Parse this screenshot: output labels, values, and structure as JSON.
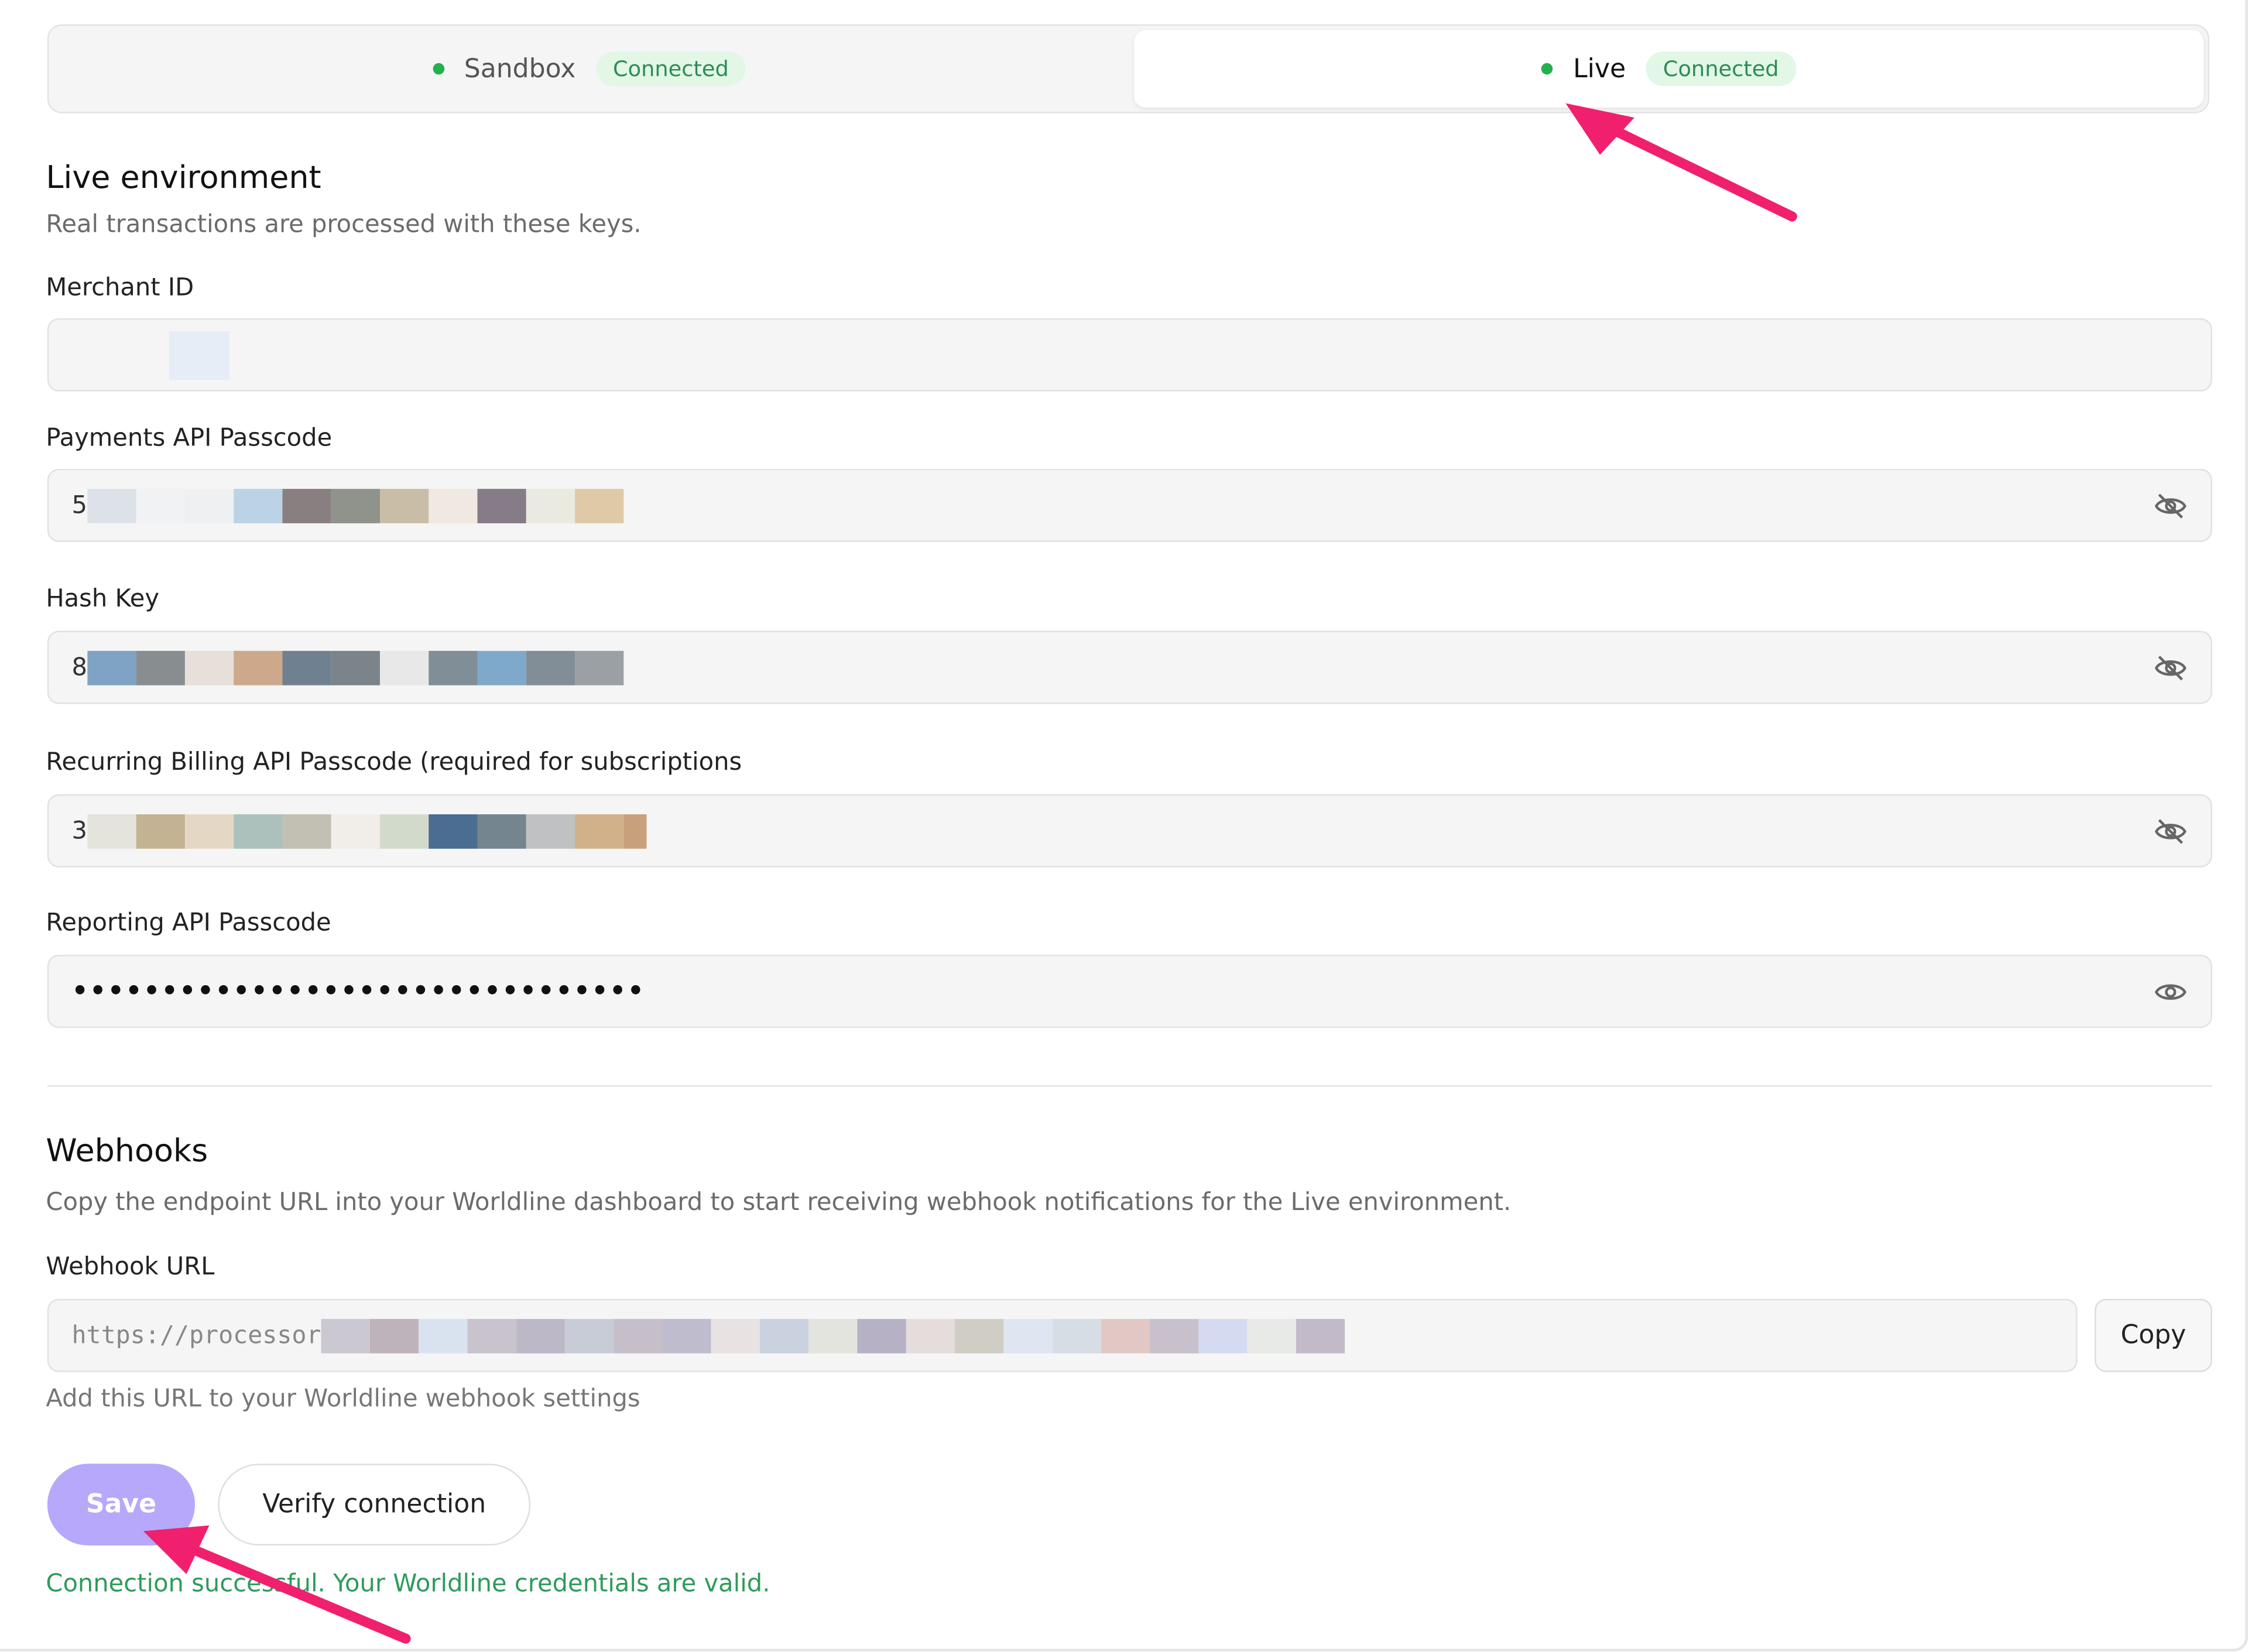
{
  "environment_switch": {
    "sandbox": {
      "label": "Sandbox",
      "status": "Connected"
    },
    "live": {
      "label": "Live",
      "status": "Connected"
    }
  },
  "live_section": {
    "title": "Live environment",
    "subtitle": "Real transactions are processed with these keys."
  },
  "fields": {
    "merchant_id": {
      "label": "Merchant ID"
    },
    "payments_passcode": {
      "label": "Payments API Passcode",
      "value_prefix": "5"
    },
    "hash_key": {
      "label": "Hash Key",
      "value_prefix": "8"
    },
    "recurring_passcode": {
      "label": "Recurring Billing API Passcode (required for subscriptions",
      "value_prefix": "3"
    },
    "reporting_passcode": {
      "label": "Reporting API Passcode",
      "masked": "••••••••••••••••••••••••••••••••"
    }
  },
  "webhooks": {
    "title": "Webhooks",
    "subtitle": "Copy the endpoint URL into your Worldline dashboard to start receiving webhook notifications for the Live environment.",
    "url_label": "Webhook URL",
    "url_prefix": "https://processor",
    "copy_label": "Copy",
    "hint": "Add this URL to your Worldline webhook settings"
  },
  "actions": {
    "save_label": "Save",
    "verify_label": "Verify connection"
  },
  "status_message": "Connection successful. Your Worldline credentials are valid.",
  "colors": {
    "accent": "#b7a8fb",
    "success": "#2e9b5a",
    "annotation_arrow": "#f0206e"
  }
}
